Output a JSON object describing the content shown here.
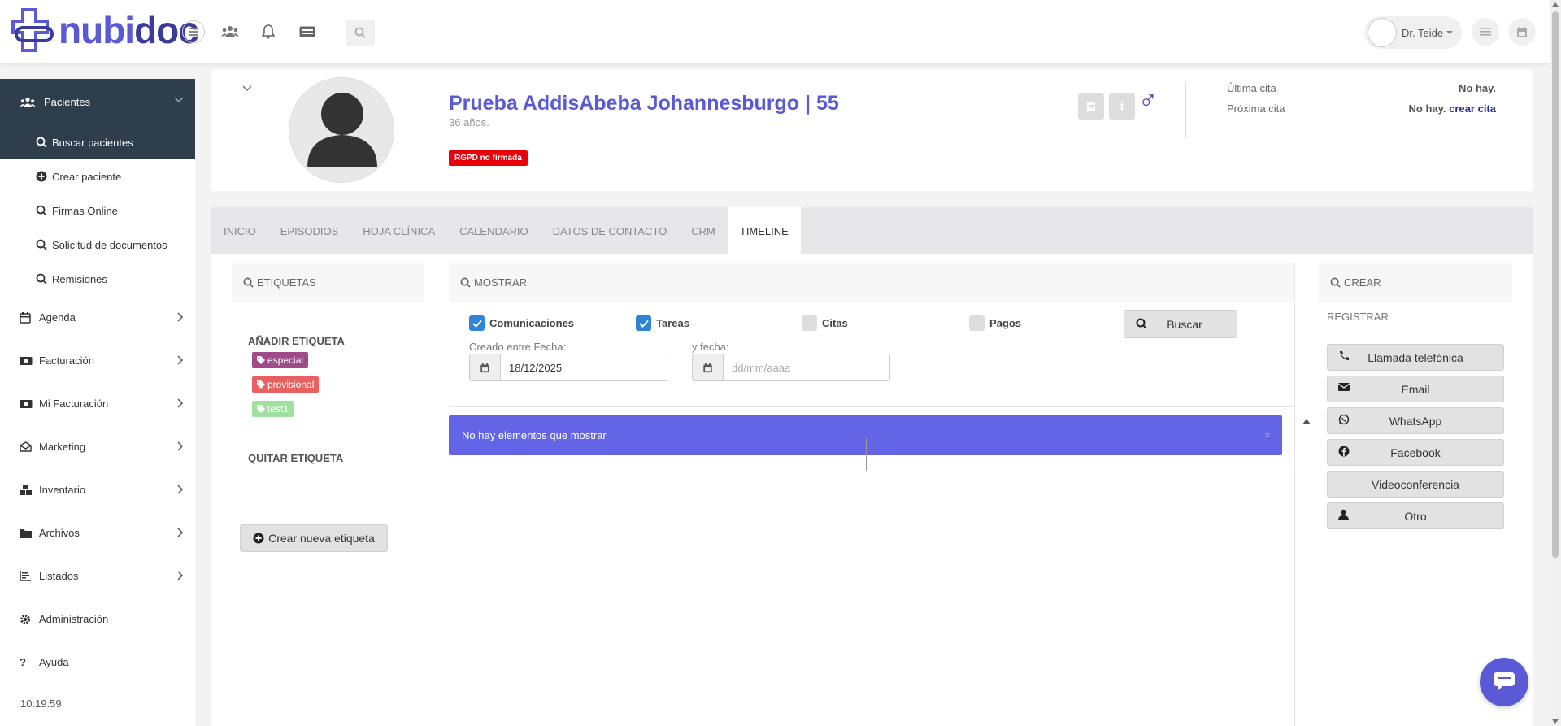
{
  "app": {
    "logo_part1": "nubi",
    "logo_part2": "doc"
  },
  "topbar": {
    "user_name": "Dr. Teide",
    "icons": [
      "hamburger-icon",
      "users-icon",
      "bell-icon",
      "card-icon",
      "search-icon",
      "menu-icon",
      "calendar-icon"
    ]
  },
  "sidebar": {
    "section": {
      "label": "Pacientes",
      "icon": "users-icon"
    },
    "subitems": [
      {
        "label": "Buscar pacientes",
        "icon": "search-icon"
      },
      {
        "label": "Crear paciente",
        "icon": "plus-circle-icon"
      },
      {
        "label": "Firmas Online",
        "icon": "search-icon"
      },
      {
        "label": "Solicitud de documentos",
        "icon": "search-icon"
      },
      {
        "label": "Remisiones",
        "icon": "search-icon"
      }
    ],
    "items": [
      {
        "label": "Agenda",
        "icon": "calendar-icon"
      },
      {
        "label": "Facturación",
        "icon": "money-icon"
      },
      {
        "label": "Mi Facturación",
        "icon": "money-icon"
      },
      {
        "label": "Marketing",
        "icon": "envelope-icon"
      },
      {
        "label": "Inventario",
        "icon": "cubes-icon"
      },
      {
        "label": "Archivos",
        "icon": "folder-icon"
      },
      {
        "label": "Listados",
        "icon": "list-icon"
      },
      {
        "label": "Administración",
        "icon": "gear-icon"
      },
      {
        "label": "Ayuda",
        "icon": "question-icon"
      }
    ],
    "time": "10:19:59"
  },
  "patient": {
    "name": "Prueba AddisAbeba Johannesburgo | 55",
    "age": "36 años.",
    "badge": "RGPD no firmada",
    "ultima_label": "Última cita",
    "ultima_value": "No hay.",
    "proxima_label": "Próxima cita",
    "proxima_value": "No hay.",
    "proxima_link": "crear cita",
    "gender_symbol": "♂"
  },
  "tabs": [
    "INICIO",
    "EPISODIOS",
    "HOJA CLÍNICA",
    "CALENDARIO",
    "DATOS DE CONTACTO",
    "CRM",
    "TIMELINE"
  ],
  "active_tab": "TIMELINE",
  "etiquetas": {
    "header": "ETIQUETAS",
    "add_title": "AÑADIR ETIQUETA",
    "tags": [
      {
        "label": "especial",
        "color": "#a04a8a"
      },
      {
        "label": "provisional",
        "color": "#e86060"
      },
      {
        "label": "test1",
        "color": "#9fe0a0"
      }
    ],
    "remove_title": "QUITAR ETIQUETA",
    "create_button": "Crear nueva etiqueta"
  },
  "mostrar": {
    "header": "MOSTRAR",
    "checks": [
      {
        "label": "Comunicaciones",
        "checked": true
      },
      {
        "label": "Tareas",
        "checked": true
      },
      {
        "label": "Citas",
        "checked": false
      },
      {
        "label": "Pagos",
        "checked": false
      }
    ],
    "search_button": "Buscar",
    "from_label": "Creado entre Fecha:",
    "from_value": "18/12/2025",
    "to_label": "y fecha:",
    "to_placeholder": "dd/mm/aaaa",
    "alert": "No hay elementos que mostrar",
    "alert_close": "×"
  },
  "crear": {
    "header": "CREAR",
    "register_label": "REGISTRAR",
    "buttons": [
      {
        "label": "Llamada telefónica",
        "icon": "phone-icon"
      },
      {
        "label": "Email",
        "icon": "envelope-icon"
      },
      {
        "label": "WhatsApp",
        "icon": "whatsapp-icon"
      },
      {
        "label": "Facebook",
        "icon": "facebook-icon"
      },
      {
        "label": "Videoconferencia",
        "icon": ""
      },
      {
        "label": "Otro",
        "icon": "user-icon"
      }
    ]
  },
  "colors": {
    "brand": "#5a5ad6",
    "sidebar_active": "#2f3e4c",
    "alert": "#6365e6",
    "badge_red": "#e8000b",
    "check_blue": "#2f84d8"
  }
}
